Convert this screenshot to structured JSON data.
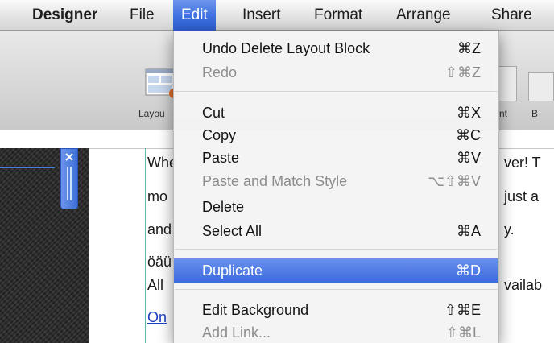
{
  "menubar": {
    "app_name": "Designer",
    "items": [
      "File",
      "Edit",
      "Insert",
      "Format",
      "Arrange",
      "Share"
    ]
  },
  "toolbar": {
    "labels": [
      "Layou",
      "nt",
      "B"
    ]
  },
  "document": {
    "lines": [
      "Whe",
      "mo",
      "and",
      "öäü",
      "All",
      "On"
    ],
    "right_fragments": [
      "ver! T",
      "just a",
      "y.",
      "vailab"
    ]
  },
  "edit_menu": {
    "items": [
      {
        "label": "Undo Delete Layout Block",
        "shortcut": "⌘Z",
        "enabled": true
      },
      {
        "label": "Redo",
        "shortcut": "⇧⌘Z",
        "enabled": false
      },
      {
        "label": "Cut",
        "shortcut": "⌘X",
        "enabled": true
      },
      {
        "label": "Copy",
        "shortcut": "⌘C",
        "enabled": true
      },
      {
        "label": "Paste",
        "shortcut": "⌘V",
        "enabled": true
      },
      {
        "label": "Paste and Match Style",
        "shortcut": "⌥⇧⌘V",
        "enabled": false
      },
      {
        "label": "Delete",
        "shortcut": "",
        "enabled": true
      },
      {
        "label": "Select All",
        "shortcut": "⌘A",
        "enabled": true
      },
      {
        "label": "Duplicate",
        "shortcut": "⌘D",
        "enabled": true,
        "highlighted": true
      },
      {
        "label": "Edit Background",
        "shortcut": "⇧⌘E",
        "enabled": true
      },
      {
        "label": "Add Link...",
        "shortcut": "⇧⌘L",
        "enabled": false
      }
    ]
  },
  "colors": {
    "accent": "#3d6fe0",
    "link": "#1c3fbf"
  }
}
